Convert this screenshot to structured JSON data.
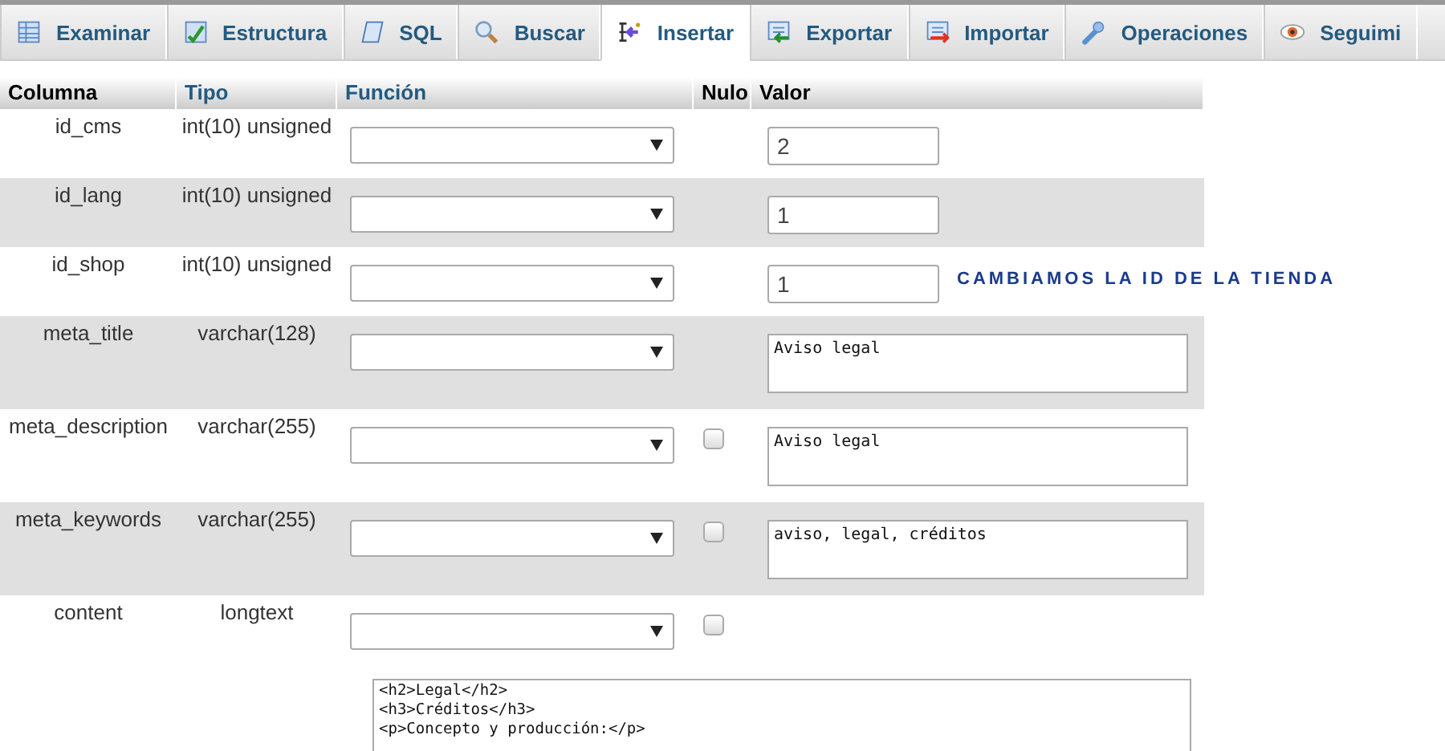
{
  "tabs": [
    {
      "label": "Examinar",
      "selected": false
    },
    {
      "label": "Estructura",
      "selected": false
    },
    {
      "label": "SQL",
      "selected": false
    },
    {
      "label": "Buscar",
      "selected": false
    },
    {
      "label": "Insertar",
      "selected": true
    },
    {
      "label": "Exportar",
      "selected": false
    },
    {
      "label": "Importar",
      "selected": false
    },
    {
      "label": "Operaciones",
      "selected": false
    },
    {
      "label": "Seguimi",
      "selected": false
    }
  ],
  "table": {
    "columns": [
      "Columna",
      "Tipo",
      "Función",
      "Nulo",
      "Valor"
    ],
    "rows": [
      {
        "column": "id_cms",
        "type": "int(10) unsigned",
        "kind": "input",
        "value": "2"
      },
      {
        "column": "id_lang",
        "type": "int(10) unsigned",
        "kind": "input",
        "value": "1"
      },
      {
        "column": "id_shop",
        "type": "int(10) unsigned",
        "kind": "input",
        "value": "1",
        "note": "CAMBIAMOS LA ID DE LA TIENDA"
      },
      {
        "column": "meta_title",
        "type": "varchar(128)",
        "kind": "textarea",
        "value": "Aviso legal"
      },
      {
        "column": "meta_description",
        "type": "varchar(255)",
        "kind": "textarea",
        "value": "Aviso legal",
        "null_checked": false
      },
      {
        "column": "meta_keywords",
        "type": "varchar(255)",
        "kind": "textarea",
        "value": "aviso, legal, créditos",
        "null_checked": false
      },
      {
        "column": "content",
        "type": "longtext",
        "kind": "editor",
        "value": "<h2>Legal</h2>\n<h3>Créditos</h3>\n<p>Concepto y producción:</p>",
        "null_checked": false
      }
    ]
  }
}
